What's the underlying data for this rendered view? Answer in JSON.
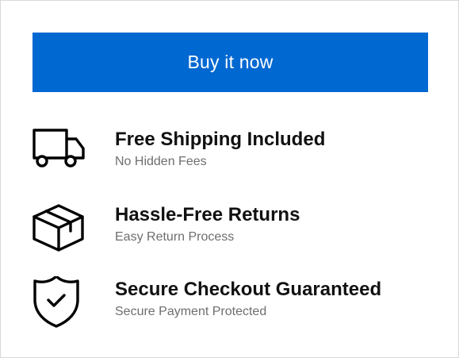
{
  "buy_button": {
    "label": "Buy it now",
    "color": "#0068d1"
  },
  "features": [
    {
      "icon": "truck-icon",
      "title": "Free Shipping Included",
      "subtitle": "No Hidden Fees"
    },
    {
      "icon": "box-icon",
      "title": "Hassle-Free Returns",
      "subtitle": "Easy Return Process"
    },
    {
      "icon": "shield-check-icon",
      "title": "Secure Checkout Guaranteed",
      "subtitle": "Secure Payment Protected"
    }
  ]
}
